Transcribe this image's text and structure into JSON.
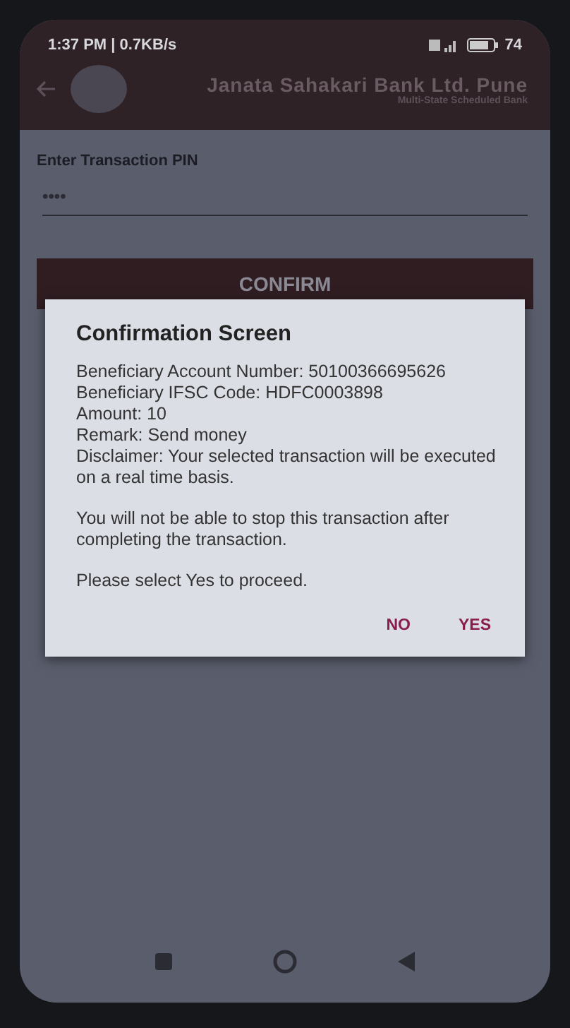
{
  "status_bar": {
    "time_speed": "1:37 PM | 0.7KB/s",
    "battery": "74"
  },
  "header": {
    "bank_name": "Janata Sahakari Bank Ltd. Pune",
    "subtitle": "Multi-State Scheduled Bank"
  },
  "pin_field": {
    "label": "Enter Transaction PIN",
    "value": "••••"
  },
  "confirm_button": "CONFIRM",
  "dialog": {
    "title": "Confirmation Screen",
    "paragraphs": [
      "Beneficiary Account Number: 50100366695626\nBeneficiary IFSC Code: HDFC0003898\nAmount: 10\nRemark: Send money\nDisclaimer: Your selected transaction will be executed on a real time basis.",
      "You will not be able to stop this transaction after completing the transaction.",
      "Please select Yes to proceed."
    ],
    "buttons": [
      "NO",
      "YES"
    ]
  }
}
